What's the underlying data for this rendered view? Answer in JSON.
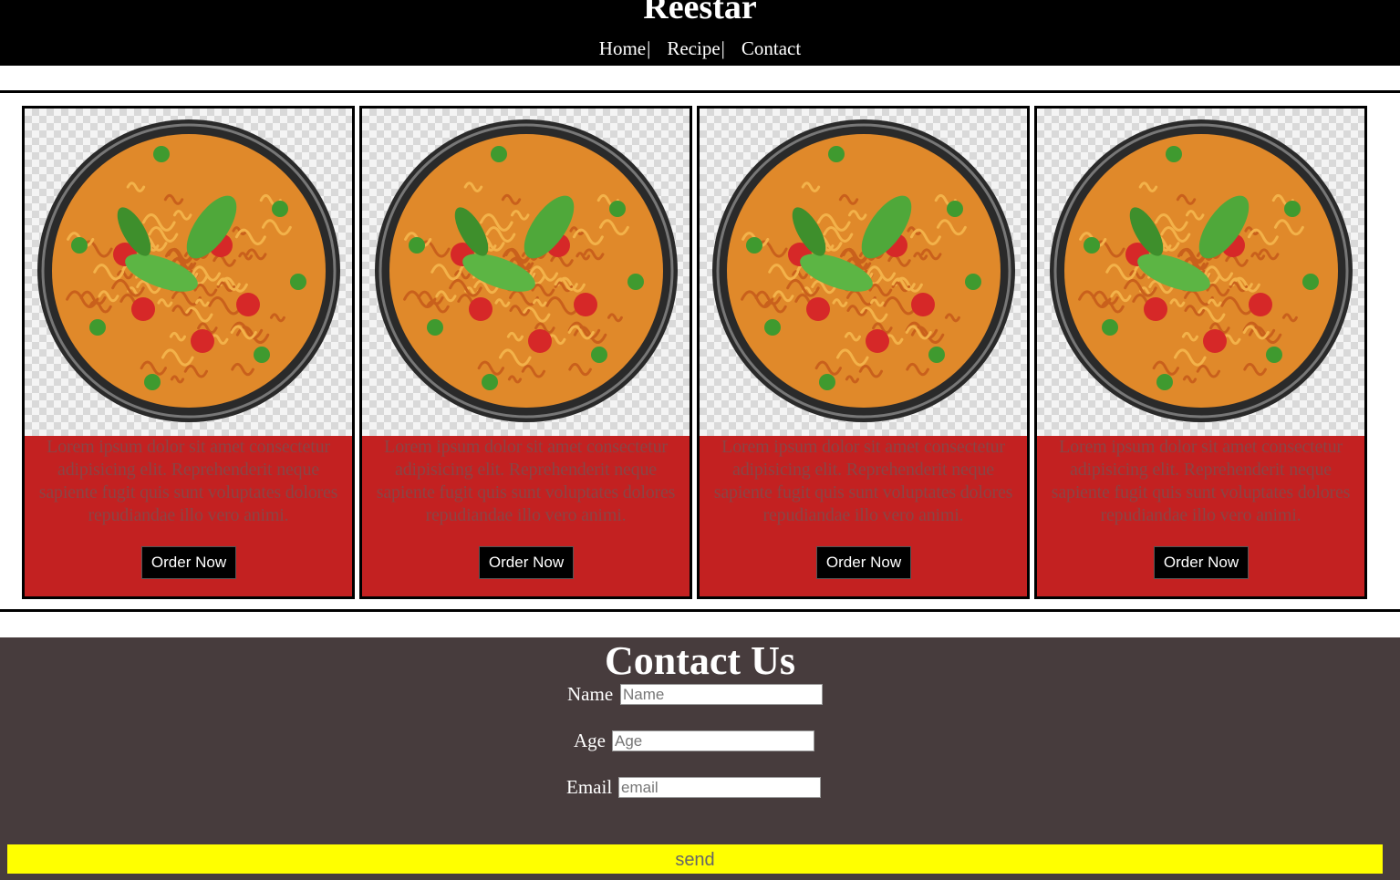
{
  "header": {
    "brand": "Reestar",
    "nav": [
      {
        "label": "Home",
        "sep": "|"
      },
      {
        "label": "Recipe",
        "sep": "|"
      },
      {
        "label": "Contact",
        "sep": ""
      }
    ]
  },
  "cards": [
    {
      "image_alt": "noodle-bowl",
      "text": "Lorem ipsum dolor sit amet consectetur adipisicing elit. Reprehenderit neque sapiente fugit quis sunt voluptates dolores repudiandae illo vero animi.",
      "button": "Order Now"
    },
    {
      "image_alt": "noodle-bowl",
      "text": "Lorem ipsum dolor sit amet consectetur adipisicing elit. Reprehenderit neque sapiente fugit quis sunt voluptates dolores repudiandae illo vero animi.",
      "button": "Order Now"
    },
    {
      "image_alt": "noodle-bowl",
      "text": "Lorem ipsum dolor sit amet consectetur adipisicing elit. Reprehenderit neque sapiente fugit quis sunt voluptates dolores repudiandae illo vero animi.",
      "button": "Order Now"
    },
    {
      "image_alt": "noodle-bowl",
      "text": "Lorem ipsum dolor sit amet consectetur adipisicing elit. Reprehenderit neque sapiente fugit quis sunt voluptates dolores repudiandae illo vero animi.",
      "button": "Order Now"
    }
  ],
  "contact": {
    "title": "Contact Us",
    "fields": [
      {
        "label": "Name",
        "placeholder": "Name",
        "value": ""
      },
      {
        "label": "Age",
        "placeholder": "Age",
        "value": ""
      },
      {
        "label": "Email",
        "placeholder": "email",
        "value": ""
      }
    ],
    "send_label": "send"
  },
  "colors": {
    "header_bg": "#000000",
    "card_bg": "#c32121",
    "contact_bg": "#473c3d",
    "send_bg": "#ffff00"
  }
}
